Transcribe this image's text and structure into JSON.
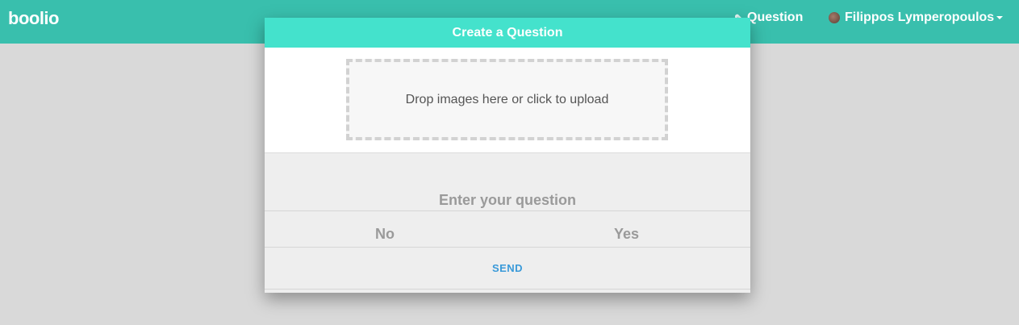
{
  "app": {
    "logo_text": "boolio"
  },
  "navbar": {
    "question_link": "Question",
    "user_name": "Filippos Lymperopoulos"
  },
  "modal": {
    "title": "Create a Question",
    "dropzone_text": "Drop images here or click to upload",
    "question_placeholder": "Enter your question",
    "question_value": "",
    "answer_no": "No",
    "answer_yes": "Yes",
    "send_label": "SEND"
  },
  "colors": {
    "navbar": "#39bfad",
    "modal_header": "#44e2cc",
    "send_text": "#3a9ad9",
    "background": "#d9d9d9"
  },
  "icons": {
    "question_icon": "pencil-icon",
    "user_menu_icon": "caret-down-icon"
  }
}
